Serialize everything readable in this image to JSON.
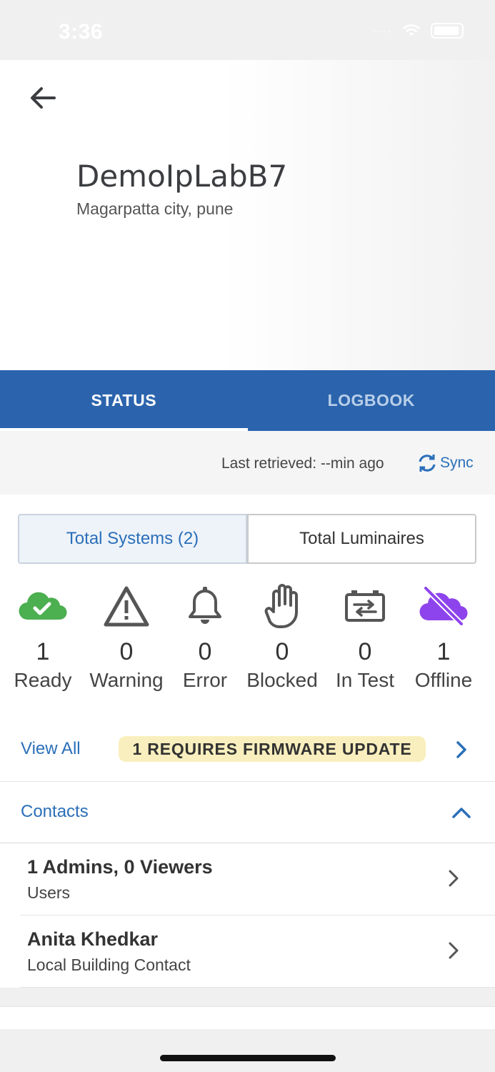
{
  "status_bar": {
    "time": "3:36",
    "signal": "····"
  },
  "header": {
    "site_name": "DemoIpLabB7",
    "address": "Magarpatta city, pune"
  },
  "tabs": [
    {
      "label": "STATUS",
      "active": true
    },
    {
      "label": "LOGBOOK",
      "active": false
    }
  ],
  "retrieval": {
    "text": "Last retrieved: --min ago",
    "sync_label": "Sync"
  },
  "segments": [
    {
      "label": "Total Systems (2)",
      "selected": true
    },
    {
      "label": "Total Luminaires",
      "selected": false
    }
  ],
  "stats": [
    {
      "icon": "cloud-check-icon",
      "count": "1",
      "label": "Ready",
      "color": "#4caf50"
    },
    {
      "icon": "warning-triangle-icon",
      "count": "0",
      "label": "Warning",
      "color": "#555555"
    },
    {
      "icon": "bell-icon",
      "count": "0",
      "label": "Error",
      "color": "#555555"
    },
    {
      "icon": "hand-icon",
      "count": "0",
      "label": "Blocked",
      "color": "#555555"
    },
    {
      "icon": "test-battery-icon",
      "count": "0",
      "label": "In Test",
      "color": "#555555"
    },
    {
      "icon": "cloud-off-icon",
      "count": "1",
      "label": "Offline",
      "color": "#8e44ec"
    }
  ],
  "view_all": {
    "label": "View All",
    "badge": "1 REQUIRES FIRMWARE UPDATE"
  },
  "contacts": {
    "title": "Contacts",
    "rows": [
      {
        "primary": "1 Admins, 0 Viewers",
        "secondary": "Users"
      },
      {
        "primary": "Anita Khedkar",
        "secondary": "Local Building Contact"
      }
    ]
  },
  "colors": {
    "primary_blue": "#2b64ad",
    "link_blue": "#2b6fb9",
    "badge_bg": "#f9efbe"
  }
}
